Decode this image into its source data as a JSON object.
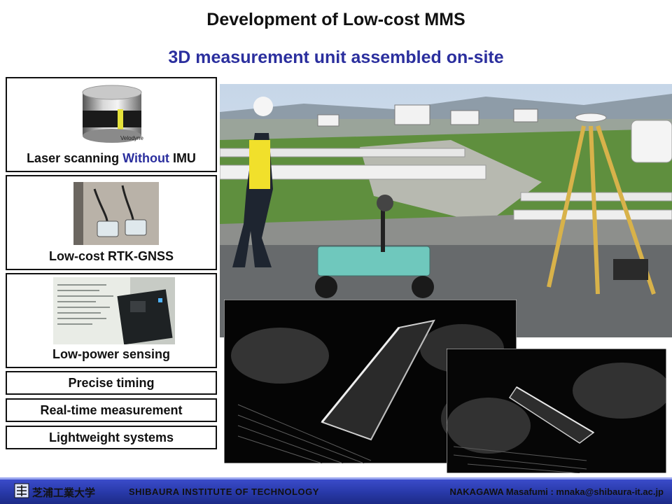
{
  "slide": {
    "title": "Development of Low-cost MMS",
    "subtitle": "3D measurement unit assembled on-site"
  },
  "features": {
    "laser_prefix": "Laser scanning ",
    "laser_highlight": "Without",
    "laser_suffix": " IMU",
    "laser_brand": "Velodyne",
    "gnss": "Low-cost RTK-GNSS",
    "power": "Low-power sensing",
    "timing": "Precise timing",
    "realtime": "Real-time measurement",
    "lightweight": "Lightweight  systems"
  },
  "footer": {
    "org_jp": "芝浦工業大学",
    "org_en": "SHIBAURA INSTITUTE OF TECHNOLOGY",
    "author": "NAKAGAWA Masafumi : mnaka@shibaura-it.ac.jp"
  },
  "colors": {
    "accent": "#2b2f9e",
    "footer_bg": "#2738a6"
  }
}
